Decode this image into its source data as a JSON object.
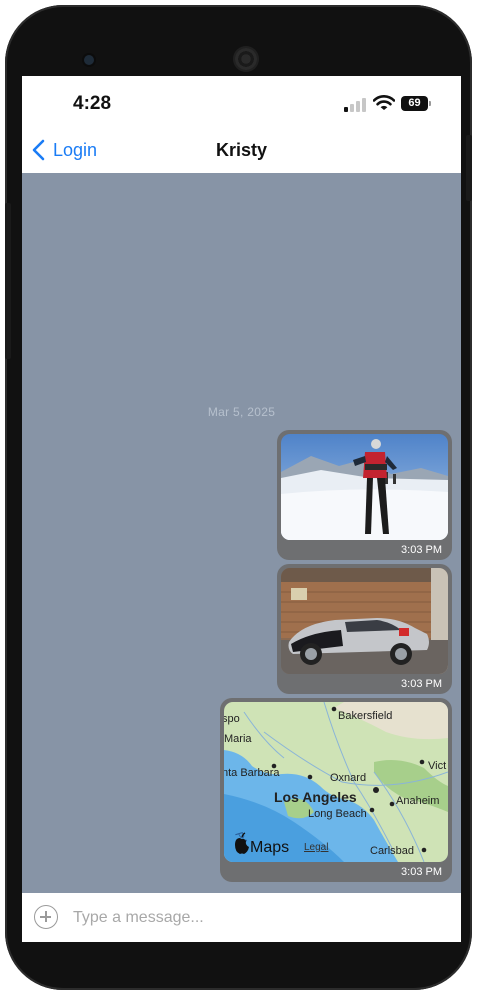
{
  "status_bar": {
    "time": "4:28",
    "battery": "69"
  },
  "nav": {
    "back_label": "Login",
    "title": "Kristy"
  },
  "conversation": {
    "date_separator": "Mar 5, 2025",
    "messages": [
      {
        "kind": "image",
        "subject": "person standing on snow at ski slope",
        "time": "3:03 PM"
      },
      {
        "kind": "image",
        "subject": "silver sports car parked in garage",
        "time": "3:03 PM"
      },
      {
        "kind": "location",
        "subject": "map of Southern California",
        "time": "3:03 PM"
      }
    ]
  },
  "map": {
    "labels": [
      "spo",
      "Bakersfield",
      "Maria",
      "Vict",
      "nta Barbara",
      "Oxnard",
      "Los Angeles",
      "Anaheim",
      "Long Beach",
      "Carlsbad"
    ],
    "brand": "Maps",
    "legal": "Legal"
  },
  "input": {
    "placeholder": "Type a message..."
  },
  "colors": {
    "accent": "#1a7cf5",
    "chat_background": "#8794a6",
    "bubble": "#6e6f71"
  }
}
